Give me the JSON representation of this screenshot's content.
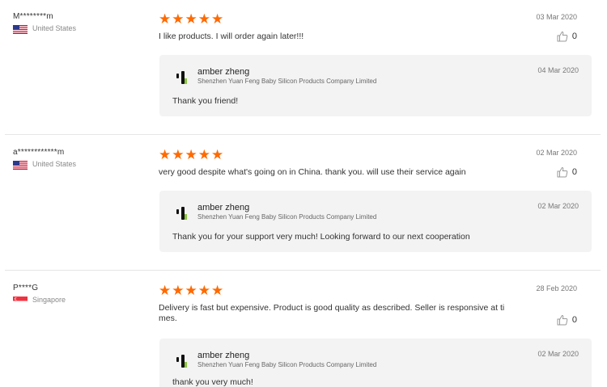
{
  "reviews": [
    {
      "user": "M********m",
      "country": "United States",
      "date": "03 Mar 2020",
      "text": "I like products. I will order again later!!!",
      "likes": "0",
      "reply": {
        "seller": "amber zheng",
        "company": "Shenzhen Yuan Feng Baby Silicon Products Company Limited",
        "date": "04 Mar 2020",
        "text": "Thank you friend!"
      }
    },
    {
      "user": "a************m",
      "country": "United States",
      "date": "02 Mar 2020",
      "text": "very good despite what's going on in China. thank you. will use their service again",
      "likes": "0",
      "reply": {
        "seller": "amber zheng",
        "company": "Shenzhen Yuan Feng Baby Silicon Products Company Limited",
        "date": "02 Mar 2020",
        "text": "Thank you for your support very much! Looking forward to our next cooperation"
      }
    },
    {
      "user": "P****G",
      "country": "Singapore",
      "date": "28 Feb 2020",
      "text": "Delivery is fast but expensive. Product is good quality as described. Seller is responsive at ti mes.",
      "likes": "0",
      "reply": {
        "seller": "amber zheng",
        "company": "Shenzhen Yuan Feng Baby Silicon Products Company Limited",
        "date": "02 Mar 2020",
        "text": "thank you very much!"
      }
    }
  ],
  "rating_stars": 5,
  "colors": {
    "star": "#ff6a00",
    "reply_bg": "#f3f3f3"
  },
  "icons": {
    "like": "thumbs-up-icon",
    "seller": "seller-avatar-icon",
    "flag_us": "us-flag-icon",
    "flag_sg": "singapore-flag-icon"
  }
}
